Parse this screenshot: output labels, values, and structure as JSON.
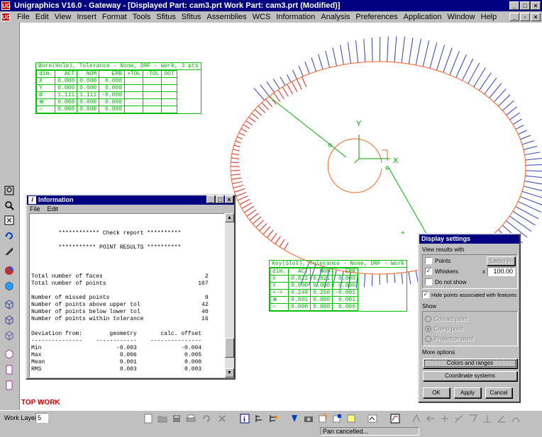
{
  "window": {
    "title": "Unigraphics V16.0 - Gateway - [Displayed Part: cam3.prt   Work Part: cam3.prt (Modified)]",
    "app_icon": "UG"
  },
  "menu": [
    "File",
    "Edit",
    "View",
    "Insert",
    "Format",
    "Tools",
    "Sfitus",
    "Sfitus",
    "Assemblies",
    "WCS",
    "Information",
    "Analysis",
    "Preferences",
    "Application",
    "Window",
    "Help"
  ],
  "graphics": {
    "top_work_label": "TOP WORK",
    "axis_y": "Y",
    "axis_x": "X"
  },
  "bore_table": {
    "title": "Bore(Hole), Tolerance - None, DRF - Work, 3 pts",
    "headers": [
      "dim.",
      "ACT",
      "NOM",
      "ERR",
      "+TOL",
      "-TOL",
      "OOT"
    ],
    "rows": [
      [
        "X",
        "0.000",
        "0.000",
        "0.000",
        "",
        "",
        ""
      ],
      [
        "Y",
        "0.000",
        "0.000",
        "0.000",
        "",
        "",
        ""
      ],
      [
        "Ø",
        "1.111",
        "1.111",
        "-0.000",
        "",
        "",
        ""
      ],
      [
        "⊕",
        "0.000",
        "0.000",
        "0.000",
        "",
        "",
        ""
      ],
      [
        "○",
        "0.000",
        "0.000",
        "0.000",
        "",
        "",
        ""
      ]
    ]
  },
  "keyslot_table": {
    "title": "Key(Slot), Tolerance - None, DRF - Work",
    "headers": [
      "dim.",
      "ACT",
      "NOM",
      "ERR"
    ],
    "rows": [
      [
        "X",
        "0.821",
        "0.821",
        "0.000"
      ],
      [
        "Y",
        "0.000",
        "0.000",
        "0.000"
      ],
      [
        "<->",
        "0.249",
        "0.250",
        "-0.001"
      ],
      [
        "⊕",
        "0.001",
        "0.000",
        "0.001"
      ],
      [
        "○",
        "0.000",
        "0.000",
        "0.000"
      ]
    ]
  },
  "info_window": {
    "title": "Information",
    "menu": [
      "File",
      "Edit"
    ],
    "lines": [
      "",
      "",
      "        ************ Check report **********",
      "",
      "        *********** POINT RESULTS **********",
      "",
      "",
      "",
      "Total number of faces                              2",
      "Total number of points                           107",
      "",
      "Number of missed points                            9",
      "Number of points above upper tol                  42",
      "Number of points below lower tol                  40",
      "Number of points within tolerance                 16",
      "",
      "Deviation from:        geometry       calc. offset",
      "---------------    ------------    ---------------",
      "Min                      -0.003             -0.004",
      "Max                       0.006              0.005",
      "Mean                      0.001              0.000",
      "RMS                       0.003              0.003"
    ]
  },
  "display_settings": {
    "title": "Display settings",
    "view_results_label": "View results with",
    "points_label": "Points",
    "lasso_button": "Lasso in",
    "whiskers_label": "Whiskers",
    "multiplier_symbol": "x",
    "whisker_scale": "100.00",
    "do_not_show_label": "Do not show",
    "hide_points_label": "Hide points associated with features",
    "show_label": "Show",
    "show_options": [
      "Contact point",
      "Comp point",
      "Projection point"
    ],
    "more_options_label": "More options",
    "colors_button": "Colors and ranges",
    "coord_button": "Coordinate systems",
    "ok_button": "OK",
    "apply_button": "Apply",
    "cancel_button": "Cancel",
    "points_checked": false,
    "whiskers_checked": true,
    "do_not_show_checked": false,
    "hide_points_checked": true
  },
  "bottom": {
    "work_layer_label": "Work Layer",
    "work_layer_value": "5",
    "status_text": "Pan cancelled..."
  },
  "colors": {
    "title_bar": "#000080",
    "circle": "#ff6020",
    "whisker_out": "#3040c0",
    "whisker_in": "#e02020",
    "feature_green": "#00b000",
    "top_work": "#d00000"
  }
}
